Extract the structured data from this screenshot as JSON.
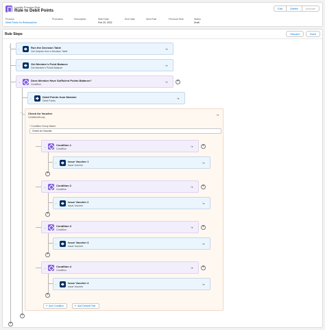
{
  "header": {
    "object_type": "Loyalty Process Rule",
    "title": "Rule to Debit Points",
    "buttons": [
      "Edit",
      "Delete",
      "Activate"
    ],
    "fields": [
      {
        "label": "Process",
        "value": "Debit Points for Redemptions",
        "link": true
      },
      {
        "label": "Promotion",
        "value": ""
      },
      {
        "label": "Description",
        "value": ""
      },
      {
        "label": "Start Date",
        "value": "Feb 20, 2022"
      },
      {
        "label": "End Date",
        "value": ""
      },
      {
        "label": "Next Rule",
        "value": ""
      },
      {
        "label": "Previous Rule",
        "value": ""
      },
      {
        "label": "Status",
        "value": "Draft"
      }
    ]
  },
  "rule_steps": {
    "title": "Rule Steps",
    "discard_label": "Discard",
    "save_label": "Save",
    "steps": [
      {
        "name": "Run the Decision Table",
        "subtitle": "Get Outputs from a Decision Table",
        "kind": "action"
      },
      {
        "name": "Get Member's Point Balance",
        "subtitle": "Get Member's Points Balance",
        "kind": "action"
      },
      {
        "name": "Does Member Have Sufficient Points Balance?",
        "subtitle": "Condition",
        "kind": "condition"
      },
      {
        "name": "Debit Points from Member",
        "subtitle": "Debit Points",
        "kind": "action"
      }
    ],
    "group": {
      "name": "Check for Voucher",
      "subtitle": "ConditionGroup",
      "field_label": "Condition Group Name",
      "field_required_mark": "*",
      "field_value": "Check for Voucher",
      "conditions": [
        {
          "name": "Condition 1",
          "subtitle": "Condition",
          "action": "Issue Voucher 1",
          "action_subtitle": "Issue Voucher"
        },
        {
          "name": "Condition 2",
          "subtitle": "Condition",
          "action": "Issue Voucher 2",
          "action_subtitle": "Issue Voucher"
        },
        {
          "name": "Condition 3",
          "subtitle": "Condition",
          "action": "Issue Voucher 3",
          "action_subtitle": "Issue Voucher"
        },
        {
          "name": "Condition 4",
          "subtitle": "Condition",
          "action": "Issue Voucher 4",
          "action_subtitle": "Issue Voucher"
        }
      ],
      "add_condition_label": "Add Condition",
      "add_default_path_label": "Add Default Path"
    }
  },
  "icons": {
    "action": "action-icon",
    "condition": "condition-icon",
    "menu": "dropdown-menu-icon",
    "add": "add-circle-icon"
  },
  "colors": {
    "accent": "#0176d3",
    "condition": "#7f5dd9",
    "action": "#032d60"
  }
}
